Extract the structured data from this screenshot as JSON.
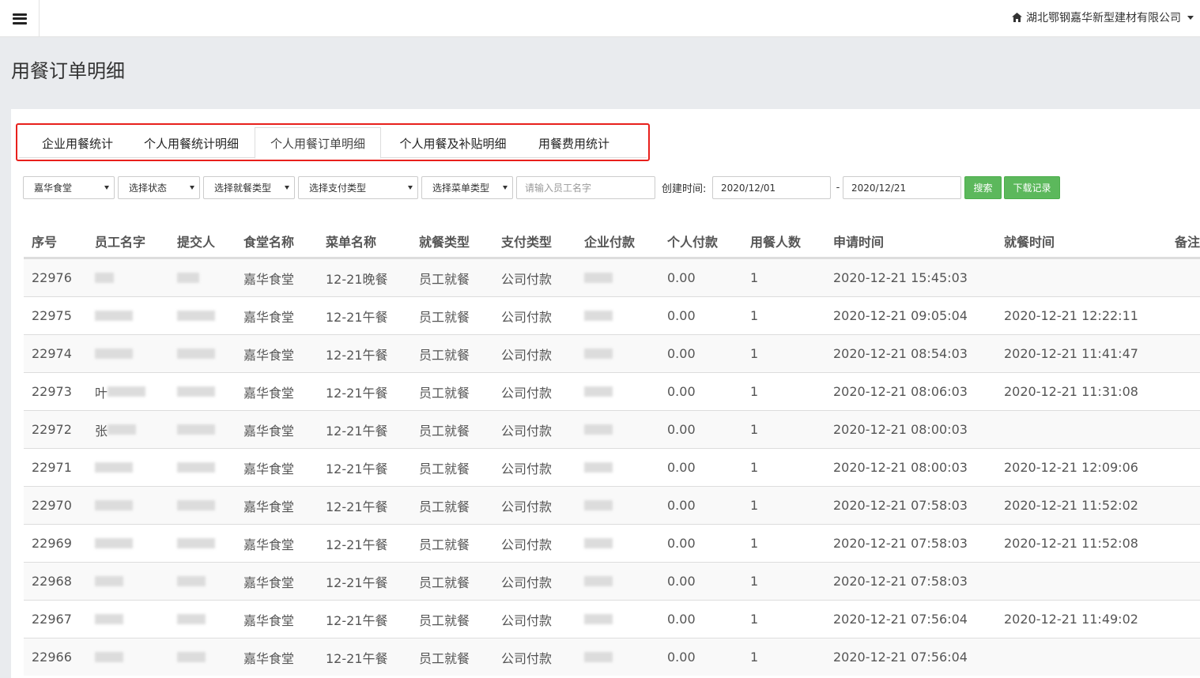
{
  "topbar": {
    "company": "湖北鄂钢嘉华新型建材有限公司",
    "menu_icon": "hamburger-icon",
    "home_icon": "home-icon"
  },
  "page_title": "用餐订单明细",
  "tabs": [
    {
      "label": "企业用餐统计",
      "active": false
    },
    {
      "label": "个人用餐统计明细",
      "active": false
    },
    {
      "label": "个人用餐订单明细",
      "active": true
    },
    {
      "label": "个人用餐及补贴明细",
      "active": false
    },
    {
      "label": "用餐费用统计",
      "active": false
    }
  ],
  "filters": {
    "canteen": "嘉华食堂",
    "status": "选择状态",
    "meal_type": "选择就餐类型",
    "pay_type": "选择支付类型",
    "menu_type": "选择菜单类型",
    "employee_placeholder": "请输入员工名字",
    "created_label": "创建时间:",
    "date_from": "2020/12/01",
    "date_sep": "-",
    "date_to": "2020/12/21",
    "search_label": "搜索",
    "download_label": "下载记录"
  },
  "table": {
    "headers": [
      "序号",
      "员工名字",
      "提交人",
      "食堂名称",
      "菜单名称",
      "就餐类型",
      "支付类型",
      "企业付款",
      "个人付款",
      "用餐人数",
      "申请时间",
      "就餐时间",
      "备注"
    ],
    "rows": [
      {
        "id": "22976",
        "name_prefix": "",
        "canteen": "嘉华食堂",
        "menu": "12-21晚餐",
        "meal_type": "员工就餐",
        "pay_type": "公司付款",
        "personal_pay": "0.00",
        "count": "1",
        "apply_time": "2020-12-21 15:45:03",
        "meal_time": ""
      },
      {
        "id": "22975",
        "name_prefix": "",
        "canteen": "嘉华食堂",
        "menu": "12-21午餐",
        "meal_type": "员工就餐",
        "pay_type": "公司付款",
        "personal_pay": "0.00",
        "count": "1",
        "apply_time": "2020-12-21 09:05:04",
        "meal_time": "2020-12-21 12:22:11"
      },
      {
        "id": "22974",
        "name_prefix": "",
        "canteen": "嘉华食堂",
        "menu": "12-21午餐",
        "meal_type": "员工就餐",
        "pay_type": "公司付款",
        "personal_pay": "0.00",
        "count": "1",
        "apply_time": "2020-12-21 08:54:03",
        "meal_time": "2020-12-21 11:41:47"
      },
      {
        "id": "22973",
        "name_prefix": "叶",
        "canteen": "嘉华食堂",
        "menu": "12-21午餐",
        "meal_type": "员工就餐",
        "pay_type": "公司付款",
        "personal_pay": "0.00",
        "count": "1",
        "apply_time": "2020-12-21 08:06:03",
        "meal_time": "2020-12-21 11:31:08"
      },
      {
        "id": "22972",
        "name_prefix": "张",
        "canteen": "嘉华食堂",
        "menu": "12-21午餐",
        "meal_type": "员工就餐",
        "pay_type": "公司付款",
        "personal_pay": "0.00",
        "count": "1",
        "apply_time": "2020-12-21 08:00:03",
        "meal_time": ""
      },
      {
        "id": "22971",
        "name_prefix": "",
        "canteen": "嘉华食堂",
        "menu": "12-21午餐",
        "meal_type": "员工就餐",
        "pay_type": "公司付款",
        "personal_pay": "0.00",
        "count": "1",
        "apply_time": "2020-12-21 08:00:03",
        "meal_time": "2020-12-21 12:09:06"
      },
      {
        "id": "22970",
        "name_prefix": "",
        "canteen": "嘉华食堂",
        "menu": "12-21午餐",
        "meal_type": "员工就餐",
        "pay_type": "公司付款",
        "personal_pay": "0.00",
        "count": "1",
        "apply_time": "2020-12-21 07:58:03",
        "meal_time": "2020-12-21 11:52:02"
      },
      {
        "id": "22969",
        "name_prefix": "",
        "canteen": "嘉华食堂",
        "menu": "12-21午餐",
        "meal_type": "员工就餐",
        "pay_type": "公司付款",
        "personal_pay": "0.00",
        "count": "1",
        "apply_time": "2020-12-21 07:58:03",
        "meal_time": "2020-12-21 11:52:08"
      },
      {
        "id": "22968",
        "name_prefix": "",
        "canteen": "嘉华食堂",
        "menu": "12-21午餐",
        "meal_type": "员工就餐",
        "pay_type": "公司付款",
        "personal_pay": "0.00",
        "count": "1",
        "apply_time": "2020-12-21 07:58:03",
        "meal_time": ""
      },
      {
        "id": "22967",
        "name_prefix": "",
        "canteen": "嘉华食堂",
        "menu": "12-21午餐",
        "meal_type": "员工就餐",
        "pay_type": "公司付款",
        "personal_pay": "0.00",
        "count": "1",
        "apply_time": "2020-12-21 07:56:04",
        "meal_time": "2020-12-21 11:49:02"
      },
      {
        "id": "22966",
        "name_prefix": "",
        "canteen": "嘉华食堂",
        "menu": "12-21午餐",
        "meal_type": "员工就餐",
        "pay_type": "公司付款",
        "personal_pay": "0.00",
        "count": "1",
        "apply_time": "2020-12-21 07:56:04",
        "meal_time": ""
      }
    ]
  },
  "colors": {
    "tab_highlight_border": "#e8201c",
    "button_green": "#5cb85c",
    "background": "#e9ebee"
  }
}
